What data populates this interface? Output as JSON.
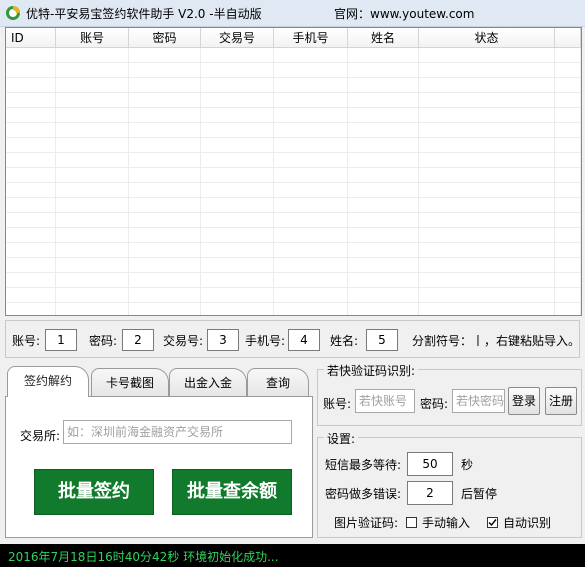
{
  "window": {
    "title": "优特-平安易宝签约软件助手 V2.0   -半自动版",
    "site": "官网：www.youtew.com"
  },
  "grid": {
    "columns": [
      "ID",
      "账号",
      "密码",
      "交易号",
      "手机号",
      "姓名",
      "状态"
    ]
  },
  "field_config": {
    "account_label": "账号:",
    "account_value": "1",
    "password_label": "密码:",
    "password_value": "2",
    "trade_label": "交易号:",
    "trade_value": "3",
    "phone_label": "手机号:",
    "phone_value": "4",
    "name_label": "姓名:",
    "name_value": "5",
    "separator_hint": "分割符号：丨，右键粘贴导入。"
  },
  "tabs": [
    {
      "label": "签约解约",
      "active": true
    },
    {
      "label": "卡号截图",
      "active": false
    },
    {
      "label": "出金入金",
      "active": false
    },
    {
      "label": "查询",
      "active": false
    }
  ],
  "sign_panel": {
    "exchange_label": "交易所:",
    "exchange_placeholder": "如：深圳前海金融资产交易所",
    "batch_sign_label": "批量签约",
    "batch_balance_label": "批量查余额"
  },
  "captcha": {
    "title": "若快验证码识别:",
    "account_label": "账号:",
    "account_placeholder": "若快账号",
    "password_label": "密码:",
    "password_placeholder": "若快密码",
    "login_label": "登录",
    "register_label": "注册"
  },
  "settings": {
    "title": "设置:",
    "sms_wait_label": "短信最多等待:",
    "sms_wait_value": "50",
    "sms_wait_unit": "秒",
    "pwd_error_label": "密码做多错误:",
    "pwd_error_value": "2",
    "pwd_error_suffix": "后暂停",
    "image_captcha_label": "图片验证码:",
    "manual_label": "手动输入",
    "manual_checked": false,
    "auto_label": "自动识别",
    "auto_checked": true
  },
  "status": {
    "message": "2016年7月18日16时40分42秒  环境初始化成功..."
  },
  "colors": {
    "accent_green": "#117a2c",
    "status_text": "#2fd35c",
    "status_bg": "#000000",
    "titlebar_bg": "#dfe8f3"
  }
}
